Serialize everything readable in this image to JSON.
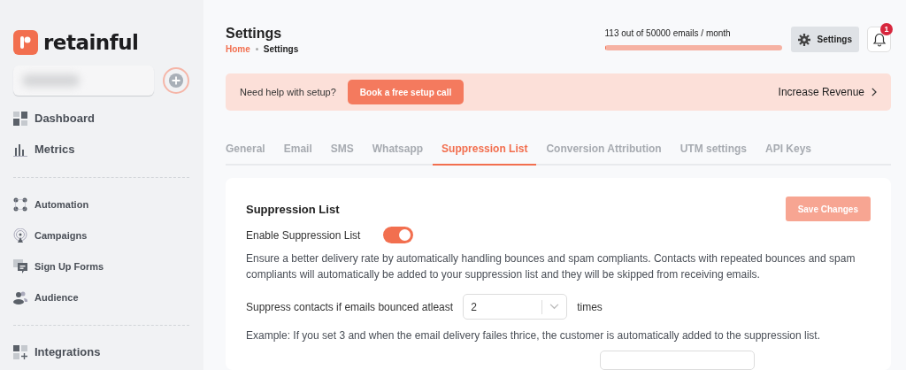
{
  "sidebar": {
    "logo": "retainful",
    "groups": [
      [
        {
          "label": "Dashboard",
          "kind": "dashboard"
        },
        {
          "label": "Metrics",
          "kind": "metrics"
        }
      ],
      [
        {
          "label": "Automation",
          "kind": "automation"
        },
        {
          "label": "Campaigns",
          "kind": "campaigns"
        },
        {
          "label": "Sign Up Forms",
          "kind": "forms"
        },
        {
          "label": "Audience",
          "kind": "audience"
        }
      ],
      [
        {
          "label": "Integrations",
          "kind": "integrations"
        }
      ]
    ]
  },
  "header": {
    "title": "Settings",
    "breadcrumb": [
      "Home",
      "Settings"
    ],
    "usage": {
      "text": "113 out of 50000 emails / month",
      "level": 0.002
    },
    "settings_button": "Settings",
    "notifications": "1"
  },
  "banner": {
    "text": "Need help with setup?",
    "button": "Book a free setup call",
    "link": "Increase Revenue"
  },
  "tabs": [
    {
      "label": "General",
      "selected": false
    },
    {
      "label": "Email",
      "selected": false
    },
    {
      "label": "SMS",
      "selected": false
    },
    {
      "label": "Whatsapp",
      "selected": false
    },
    {
      "label": "Suppression List",
      "selected": true
    },
    {
      "label": "Conversion Attribution",
      "selected": false
    },
    {
      "label": "UTM settings",
      "selected": false
    },
    {
      "label": "API Keys",
      "selected": false
    }
  ],
  "card": {
    "title": "Suppression List",
    "save_button": "Save Changes",
    "toggle": {
      "label": "Enable Suppression List",
      "on": true
    },
    "description": "Ensure a better delivery rate by automatically handling bounces and spam compliants. Contacts with repeated bounces and spam compliants will automatically be added to your suppression list and they will be skipped from receiving emails.",
    "bounce": {
      "label": "Suppress contacts if emails bounced atleast",
      "value": "2",
      "suffix": "times"
    },
    "example": "Example: If you set 3 and when the email delivery failes thrice, the customer is automatically added to the suppression list."
  }
}
